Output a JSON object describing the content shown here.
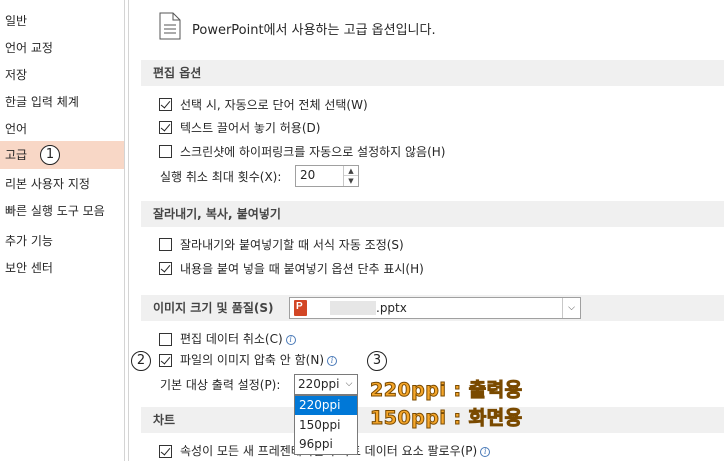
{
  "sidebar": {
    "items": [
      {
        "label": "일반"
      },
      {
        "label": "언어 교정"
      },
      {
        "label": "저장"
      },
      {
        "label": "한글 입력 체계"
      },
      {
        "label": "언어"
      },
      {
        "label": "고급",
        "active": true
      },
      {
        "label": "리본 사용자 지정"
      },
      {
        "label": "빠른 실행 도구 모음"
      },
      {
        "label": "추가 기능"
      },
      {
        "label": "보안 센터"
      }
    ]
  },
  "main": {
    "header": "PowerPoint에서 사용하는 고급 옵션입니다.",
    "sections": {
      "editing": {
        "title": "편집 옵션",
        "options": [
          {
            "label": "선택 시, 자동으로 단어 전체 선택(W)",
            "checked": true
          },
          {
            "label": "텍스트 끌어서 놓기 허용(D)",
            "checked": true
          },
          {
            "label": "스크린샷에 하이퍼링크를 자동으로 설정하지 않음(H)",
            "checked": false
          }
        ],
        "undo_label": "실행 취소 최대 횟수(X):",
        "undo_value": "20"
      },
      "clipboard": {
        "title": "잘라내기, 복사, 붙여넣기",
        "options": [
          {
            "label": "잘라내기와 붙여넣기할 때 서식 자동 조정(S)",
            "checked": false
          },
          {
            "label": "내용을 붙여 넣을 때 붙여넣기 옵션 단추 표시(H)",
            "checked": true
          }
        ]
      },
      "image": {
        "title": "이미지 크기 및 품질(S)",
        "file_name": ".pptx",
        "options": [
          {
            "label": "편집 데이터 취소(C)",
            "checked": false
          },
          {
            "label": "파일의 이미지 압축 안 함(N)",
            "checked": true
          }
        ],
        "output_label": "기본 대상 출력 설정(P):",
        "output_value": "220ppi",
        "output_options": [
          "220ppi",
          "150ppi",
          "96ppi"
        ]
      },
      "chart": {
        "title": "차트",
        "option_label": "속성이 모든 새 프레젠테이션의 차트 데이터 요소 팔로우(P)",
        "checked": true
      }
    }
  },
  "annotations": {
    "circle1": "1",
    "circle2": "2",
    "circle3": "3",
    "note1": "220ppi : 출력용",
    "note2": "150ppi : 화면용"
  },
  "colors": {
    "active_nav": "#f8d7c6",
    "section_bg": "#f0f0f0",
    "selection": "#0078d7",
    "annotation": "#f5a62a"
  }
}
